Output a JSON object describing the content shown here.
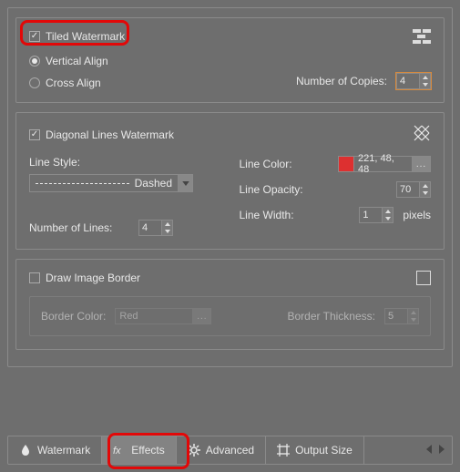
{
  "tiled": {
    "title": "Tiled Watermark",
    "checked": true,
    "options": {
      "vertical": "Vertical Align",
      "cross": "Cross Align"
    },
    "selected": "vertical",
    "copies_label": "Number of Copies:",
    "copies": "4"
  },
  "diag": {
    "title": "Diagonal Lines Watermark",
    "checked": true,
    "line_style_label": "Line Style:",
    "line_style": "Dashed",
    "num_lines_label": "Number of Lines:",
    "num_lines": "4",
    "line_color_label": "Line Color:",
    "line_color_text": "221, 48, 48",
    "line_color_hex": "#dd3030",
    "line_opacity_label": "Line Opacity:",
    "line_opacity": "70",
    "line_width_label": "Line Width:",
    "line_width": "1",
    "line_width_unit": "pixels"
  },
  "border": {
    "title": "Draw Image Border",
    "checked": false,
    "color_label": "Border Color:",
    "color_text": "Red",
    "thickness_label": "Border Thickness:",
    "thickness": "5"
  },
  "tabs": {
    "watermark": "Watermark",
    "effects": "Effects",
    "advanced": "Advanced",
    "output": "Output Size"
  },
  "misc": {
    "ellipsis": "..."
  }
}
